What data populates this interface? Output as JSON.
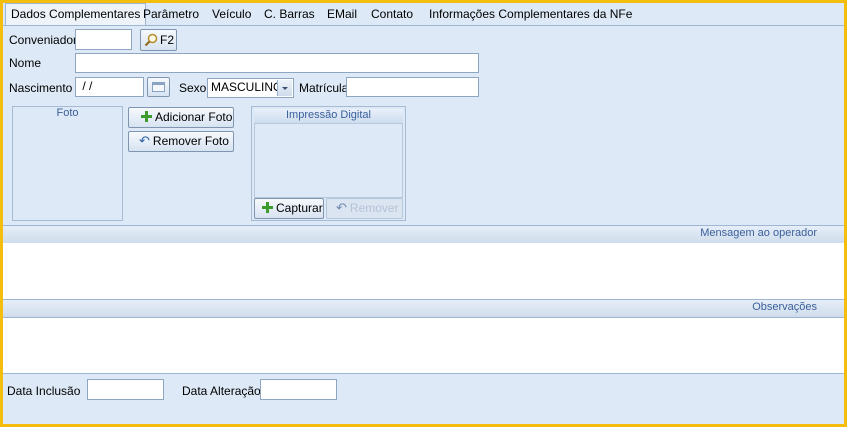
{
  "tabs": [
    {
      "label": "Dados Complementares",
      "active": true
    },
    {
      "label": "Parâmetro"
    },
    {
      "label": "Veículo"
    },
    {
      "label": "C. Barras"
    },
    {
      "label": "EMail"
    },
    {
      "label": "Contato"
    },
    {
      "label": "Informações Complementares da NFe"
    }
  ],
  "form": {
    "conveniador_label": "Conveniador",
    "conveniador_value": "",
    "search_button_label": "F2",
    "nome_label": "Nome",
    "nome_value": "",
    "nascimento_label": "Nascimento",
    "nascimento_value": " / /",
    "sexo_label": "Sexo",
    "sexo_value": "MASCULINO",
    "matricula_label": "Matrícula",
    "matricula_value": ""
  },
  "foto": {
    "title": "Foto",
    "add_label": "Adicionar Foto",
    "remove_label": "Remover Foto"
  },
  "digital": {
    "title": "Impressão Digital",
    "capture_label": "Capturar",
    "remove_label": "Remover"
  },
  "sections": {
    "mensagem_title": "Mensagem ao operador",
    "observacoes_title": "Observações"
  },
  "footer": {
    "inclusao_label": "Data Inclusão",
    "inclusao_value": "",
    "alteracao_label": "Data Alteração",
    "alteracao_value": ""
  },
  "colors": {
    "border": "#f5be0f",
    "background": "#dde9f6",
    "accent": "#3a5f9a"
  }
}
